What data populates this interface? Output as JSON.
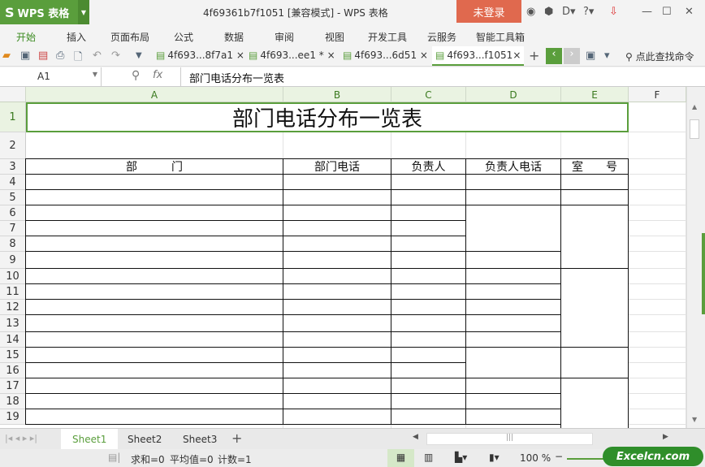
{
  "app": {
    "name": "WPS 表格",
    "window_title": "4f69361b7f1051 [兼容模式] - WPS 表格",
    "login": "未登录",
    "accent": "#5a9e3c"
  },
  "menu": [
    "开始",
    "插入",
    "页面布局",
    "公式",
    "数据",
    "审阅",
    "视图",
    "开发工具",
    "云服务",
    "智能工具箱"
  ],
  "doc_tabs": [
    {
      "label": "4f693...8f7a1"
    },
    {
      "label": "4f693...ee1 *"
    },
    {
      "label": "4f693...6d51"
    },
    {
      "label": "4f693...f1051"
    }
  ],
  "search_cmd": "点此查找命令",
  "formula": {
    "name_box": "A1",
    "fx": "fx",
    "value": "部门电话分布一览表"
  },
  "columns": [
    "A",
    "B",
    "C",
    "D",
    "E",
    "F"
  ],
  "rows": [
    "1",
    "2",
    "3",
    "4",
    "5",
    "6",
    "7",
    "8",
    "9",
    "10",
    "11",
    "12",
    "13",
    "14",
    "15",
    "16",
    "17",
    "18",
    "19"
  ],
  "table": {
    "title": "部门电话分布一览表",
    "headers": [
      "部　　　门",
      "部门电话",
      "负责人",
      "负责人电话",
      "室　　号"
    ]
  },
  "sheets": [
    "Sheet1",
    "Sheet2",
    "Sheet3"
  ],
  "status": {
    "sum": "求和=0",
    "avg": "平均值=0",
    "count": "计数=1",
    "zoom": "100 %"
  },
  "watermark": "Excelcn.com"
}
